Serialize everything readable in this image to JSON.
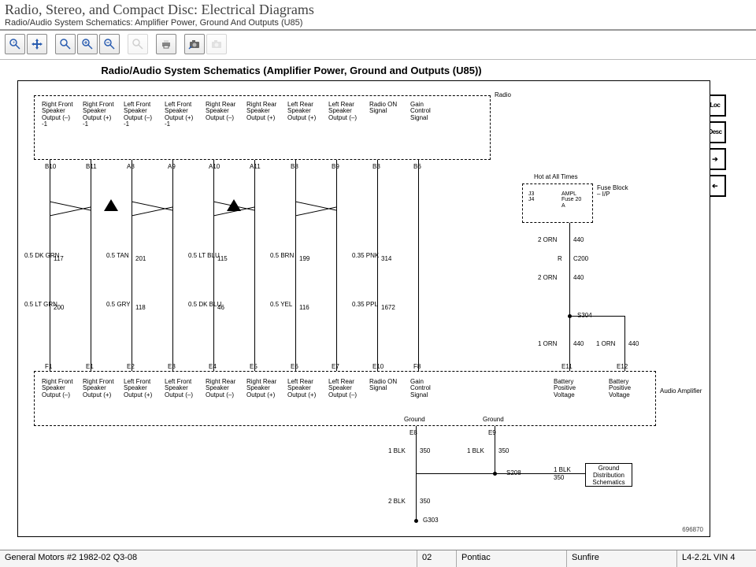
{
  "app": {
    "title": "Radio, Stereo, and Compact Disc:  Electrical Diagrams",
    "subtitle": "Radio/Audio System Schematics: Amplifier Power, Ground And Outputs (U85)"
  },
  "toolbar": {
    "zoom_rect": "Zoom Rectangle",
    "pan": "Pan",
    "zoom_in_mag": "Zoom In Tool",
    "zoom_in": "Zoom In",
    "zoom_out": "Zoom Out",
    "zoom_fit": "Fit",
    "print": "Print",
    "snapshot": "Snapshot",
    "camera": "Camera"
  },
  "nav": {
    "loc": "Loc",
    "desc": "Desc",
    "next": "→",
    "prev": "←"
  },
  "diagram": {
    "title": "Radio/Audio System Schematics (Amplifier Power, Ground and Outputs (U85))",
    "radio_block": "Radio",
    "amp_block": "Audio Amplifier",
    "fuse_block": "Fuse Block – I/P",
    "fuse_inner": "AMPL Fuse 20 A",
    "hot_label": "Hot at All Times",
    "fuse_pins": "J3\nJ4",
    "gnd_box": "Ground Distribution Schematics",
    "gnd_text1": "Ground",
    "gnd_text2": "Ground",
    "g303": "G303",
    "docnum": "696870",
    "columns": [
      {
        "top_pin": "B10",
        "bottom_pin": "F1",
        "top_label": "Right Front Speaker Output (–) -1",
        "bottom_label": "Right Front Speaker Output (–)",
        "wire1": "0.5 DK GRN",
        "ckt1": "117",
        "wire2": "0.5 LT GRN",
        "ckt2": "200"
      },
      {
        "top_pin": "B11",
        "bottom_pin": "E1",
        "top_label": "Right Front Speaker Output (+) -1",
        "bottom_label": "Right Front Speaker Output (+)"
      },
      {
        "top_pin": "A8",
        "bottom_pin": "E2",
        "top_label": "Left Front Speaker Output (–) -1",
        "bottom_label": "Left Front Speaker Output (+)",
        "wire1": "0.5 TAN",
        "ckt1": "201",
        "wire2": "0.5 GRY",
        "ckt2": "118"
      },
      {
        "top_pin": "A9",
        "bottom_pin": "E3",
        "top_label": "Left Front Speaker Output (+) -1",
        "bottom_label": "Left Front Speaker Output (–)"
      },
      {
        "top_pin": "A10",
        "bottom_pin": "E4",
        "top_label": "Right Rear Speaker Output (–)",
        "bottom_label": "Right Rear Speaker Output (–)",
        "wire1": "0.5 LT BLU",
        "ckt1": "115",
        "wire2": "0.5 DK BLU",
        "ckt2": "46"
      },
      {
        "top_pin": "A11",
        "bottom_pin": "E5",
        "top_label": "Right Rear Speaker Output (+)",
        "bottom_label": "Right Rear Speaker Output (+)"
      },
      {
        "top_pin": "B8",
        "bottom_pin": "E6",
        "top_label": "Left Rear Speaker Output (+)",
        "bottom_label": "Left Rear Speaker Output (+)",
        "wire1": "0.5 BRN",
        "ckt1": "199",
        "wire2": "0.5 YEL",
        "ckt2": "116"
      },
      {
        "top_pin": "B9",
        "bottom_pin": "E7",
        "top_label": "Left Rear Speaker Output (–)",
        "bottom_label": "Left Rear Speaker Output (–)"
      },
      {
        "top_pin": "B3",
        "bottom_pin": "E10",
        "top_label": "Radio ON Signal",
        "bottom_label": "Radio ON Signal",
        "wire1": "0.35 PNK",
        "ckt1": "314",
        "wire2": "0.35 PPL",
        "ckt2": "1672"
      },
      {
        "top_pin": "B6",
        "bottom_pin": "F8",
        "top_label": "Gain Control Signal",
        "bottom_label": "Gain Control Signal"
      }
    ],
    "right": {
      "orn1": "2 ORN",
      "c440a": "440",
      "c200": "C200",
      "c200_r": "R",
      "orn2": "2 ORN",
      "c440b": "440",
      "s304": "S304",
      "orn3": "1 ORN",
      "c440c": "440",
      "orn4": "1 ORN",
      "c440d": "440",
      "e11": "E11",
      "e12": "E12",
      "e11_label": "Battery Positive Voltage",
      "e12_label": "Battery Positive Voltage"
    },
    "ground": {
      "e8": "E8",
      "e9": "E9",
      "blk1": "1 BLK",
      "blk1c": "350",
      "blk2": "1 BLK",
      "blk2c": "350",
      "s208": "S208",
      "blk3": "1 BLK",
      "blk3c": "350",
      "blk4": "2 BLK",
      "blk4c": "350"
    }
  },
  "footer": {
    "source": "General Motors #2 1982-02 Q3-08",
    "year": "02",
    "make": "Pontiac",
    "model": "Sunfire",
    "engine": "L4-2.2L VIN 4"
  }
}
